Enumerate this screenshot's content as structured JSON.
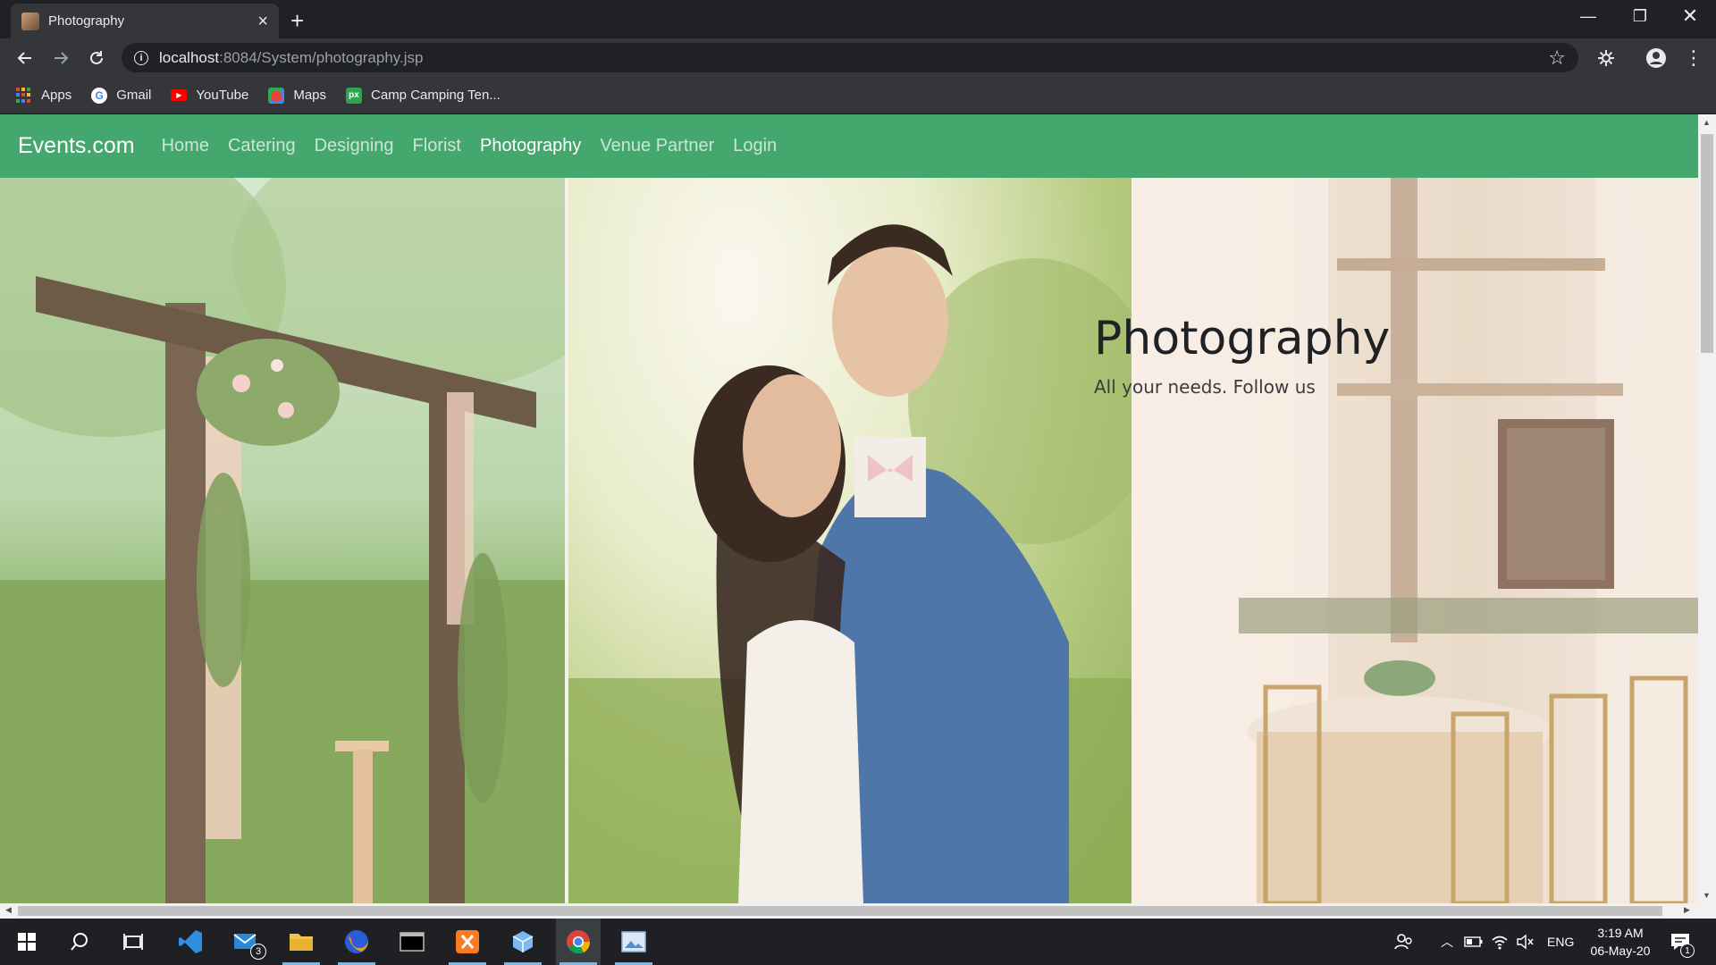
{
  "browser": {
    "tab_title": "Photography",
    "url_host": "localhost",
    "url_path": ":8084/System/photography.jsp",
    "bookmarks": [
      {
        "label": "Apps",
        "icon": "apps-grid-icon"
      },
      {
        "label": "Gmail",
        "icon": "google-icon"
      },
      {
        "label": "YouTube",
        "icon": "youtube-icon"
      },
      {
        "label": "Maps",
        "icon": "maps-icon"
      },
      {
        "label": "Camp Camping Ten...",
        "icon": "px-icon"
      }
    ]
  },
  "site": {
    "brand": "Events.com",
    "nav": [
      {
        "label": "Home"
      },
      {
        "label": "Catering"
      },
      {
        "label": "Designing"
      },
      {
        "label": "Florist"
      },
      {
        "label": "Photography"
      },
      {
        "label": "Venue Partner"
      },
      {
        "label": "Login"
      }
    ],
    "active_nav": "Photography",
    "hero": {
      "title": "Photography",
      "subtitle": "All your needs. Follow us"
    },
    "colors": {
      "navbar": "#43a76e"
    }
  },
  "taskbar": {
    "clock_time": "3:19 AM",
    "clock_date": "06-May-20",
    "language": "ENG",
    "mail_badge": "3",
    "notification_badge": "1"
  }
}
